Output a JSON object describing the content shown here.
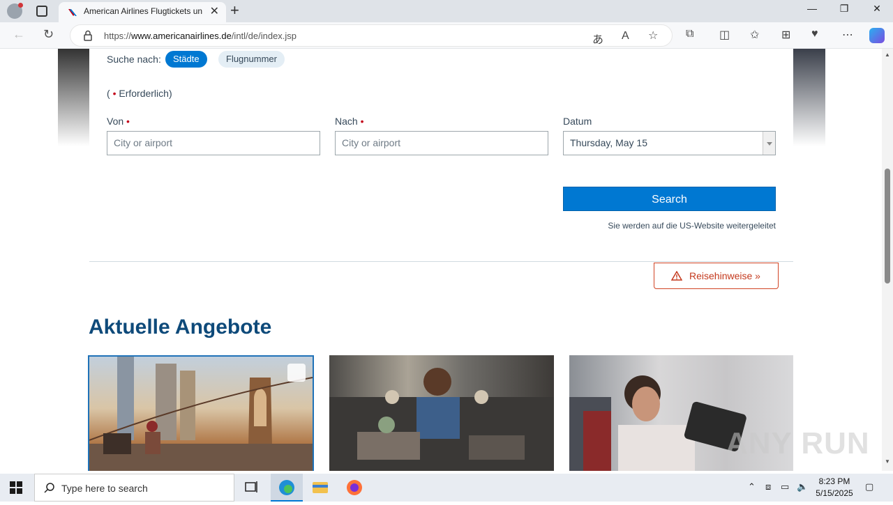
{
  "browser": {
    "tab_title": "American Airlines Flugtickets und",
    "url_prefix": "https://",
    "url_domain": "www.americanairlines.de",
    "url_path": "/intl/de/index.jsp",
    "window_controls": {
      "minimize": "—",
      "maximize": "❐",
      "close": "✕"
    }
  },
  "booking": {
    "search_by_label": "Suche nach:",
    "tab_cities": "Städte",
    "tab_flight_number": "Flugnummer",
    "required_prefix": "(",
    "required_label": "Erforderlich)",
    "from_label": "Von",
    "to_label": "Nach",
    "date_label": "Datum",
    "from_placeholder": "City or airport",
    "to_placeholder": "City or airport",
    "date_value": "Thursday, May 15",
    "search_button": "Search",
    "redirect_note": "Sie werden auf die US-Website weitergeleitet"
  },
  "advisory": {
    "label": "Reisehinweise »"
  },
  "offers": {
    "title": "Aktuelle Angebote"
  },
  "watermark": "ANY RUN",
  "taskbar": {
    "search_placeholder": "Type here to search",
    "time": "8:23 PM",
    "date": "5/15/2025"
  },
  "colors": {
    "accent": "#0078d2",
    "advisory": "#c4391d",
    "heading": "#0e4a7a"
  }
}
